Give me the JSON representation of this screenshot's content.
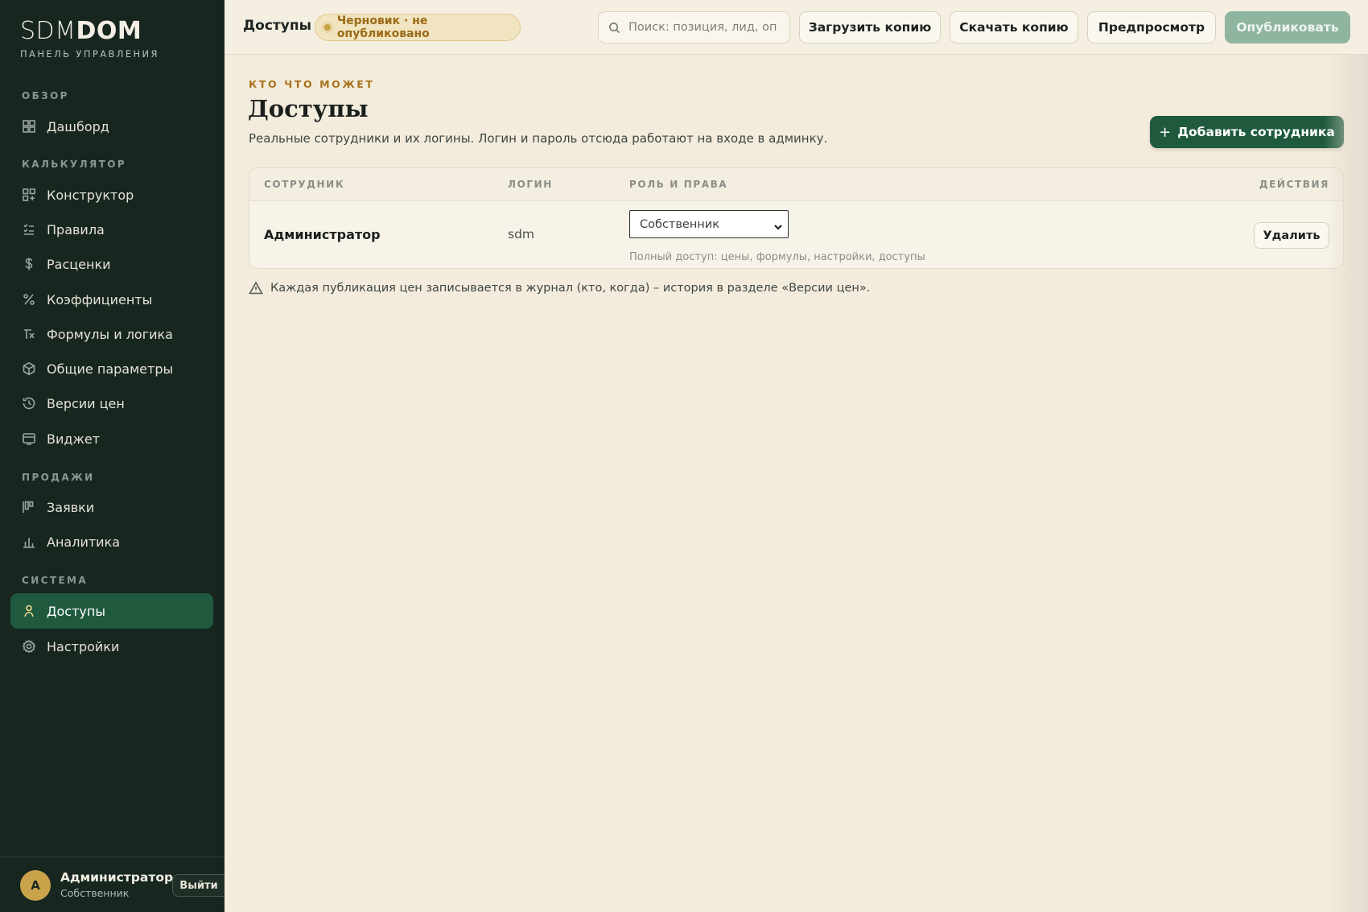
{
  "brand": {
    "logo_thin": "SDM",
    "logo_bold": "DOM",
    "subtitle": "ПАНЕЛЬ УПРАВЛЕНИЯ"
  },
  "sidebar": {
    "sections": {
      "overview": "ОБЗОР",
      "calculator": "КАЛЬКУЛЯТОР",
      "sales": "ПРОДАЖИ",
      "system": "СИСТЕМА"
    },
    "items": {
      "dashboard": "Дашборд",
      "constructor": "Конструктор",
      "rules": "Правила",
      "prices": "Расценки",
      "coefficients": "Коэффициенты",
      "formulas": "Формулы и логика",
      "params": "Общие параметры",
      "versions": "Версии цен",
      "widget": "Виджет",
      "requests": "Заявки",
      "analytics": "Аналитика",
      "access": "Доступы",
      "settings": "Настройки"
    },
    "user": {
      "initial": "A",
      "name": "Администратор",
      "role": "Собственник",
      "logout": "Выйти"
    }
  },
  "topbar": {
    "title": "Доступы",
    "badge": "Черновик · не опубликовано",
    "search_placeholder": "Поиск: позиция, лид, опция",
    "upload": "Загрузить копию",
    "download": "Скачать копию",
    "preview": "Предпросмотр",
    "publish": "Опубликовать"
  },
  "main": {
    "eyebrow": "КТО ЧТО МОЖЕТ",
    "title": "Доступы",
    "subtitle": "Реальные сотрудники и их логины. Логин и пароль отсюда работают на входе в админку.",
    "add_button": "Добавить сотрудника",
    "table": {
      "headers": {
        "employee": "СОТРУДНИК",
        "login": "ЛОГИН",
        "role": "РОЛЬ И ПРАВА",
        "actions": "ДЕЙСТВИЯ"
      },
      "rows": [
        {
          "name": "Администратор",
          "login": "sdm",
          "role": "Собственник",
          "role_desc": "Полный доступ: цены, формулы, настройки, доступы",
          "delete": "Удалить"
        }
      ]
    },
    "note": "Каждая публикация цен записывается в журнал (кто, когда) – история в разделе «Версии цен»."
  },
  "colors": {
    "sidebar_bg": "#172720",
    "accent_green": "#1f5a3f",
    "accent_gold": "#c9a24a",
    "page_bg": "#f3ecdd"
  }
}
